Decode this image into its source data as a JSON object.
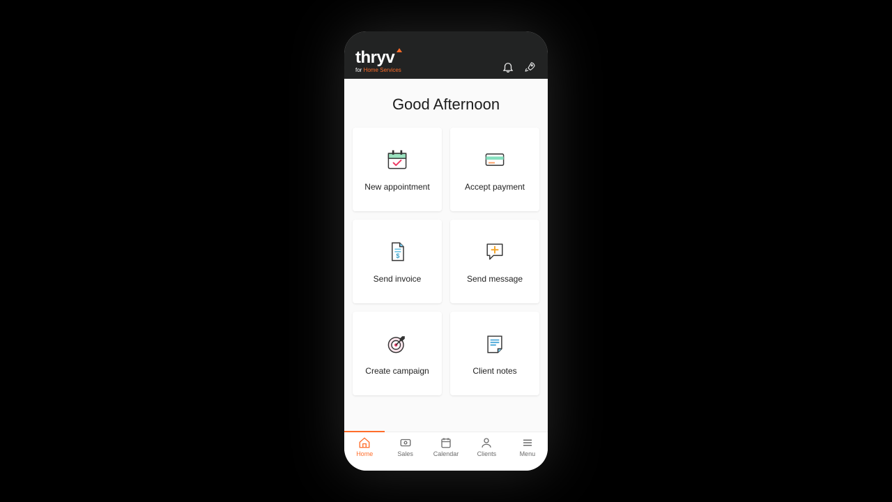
{
  "brand": {
    "main": "thryv",
    "sub_for": "for ",
    "sub_hs": "Home Services"
  },
  "greeting": "Good Afternoon",
  "tiles": [
    {
      "label": "New appointment"
    },
    {
      "label": "Accept payment"
    },
    {
      "label": "Send invoice"
    },
    {
      "label": "Send message"
    },
    {
      "label": "Create campaign"
    },
    {
      "label": "Client notes"
    }
  ],
  "nav": [
    {
      "label": "Home"
    },
    {
      "label": "Sales"
    },
    {
      "label": "Calendar"
    },
    {
      "label": "Clients"
    },
    {
      "label": "Menu"
    }
  ]
}
